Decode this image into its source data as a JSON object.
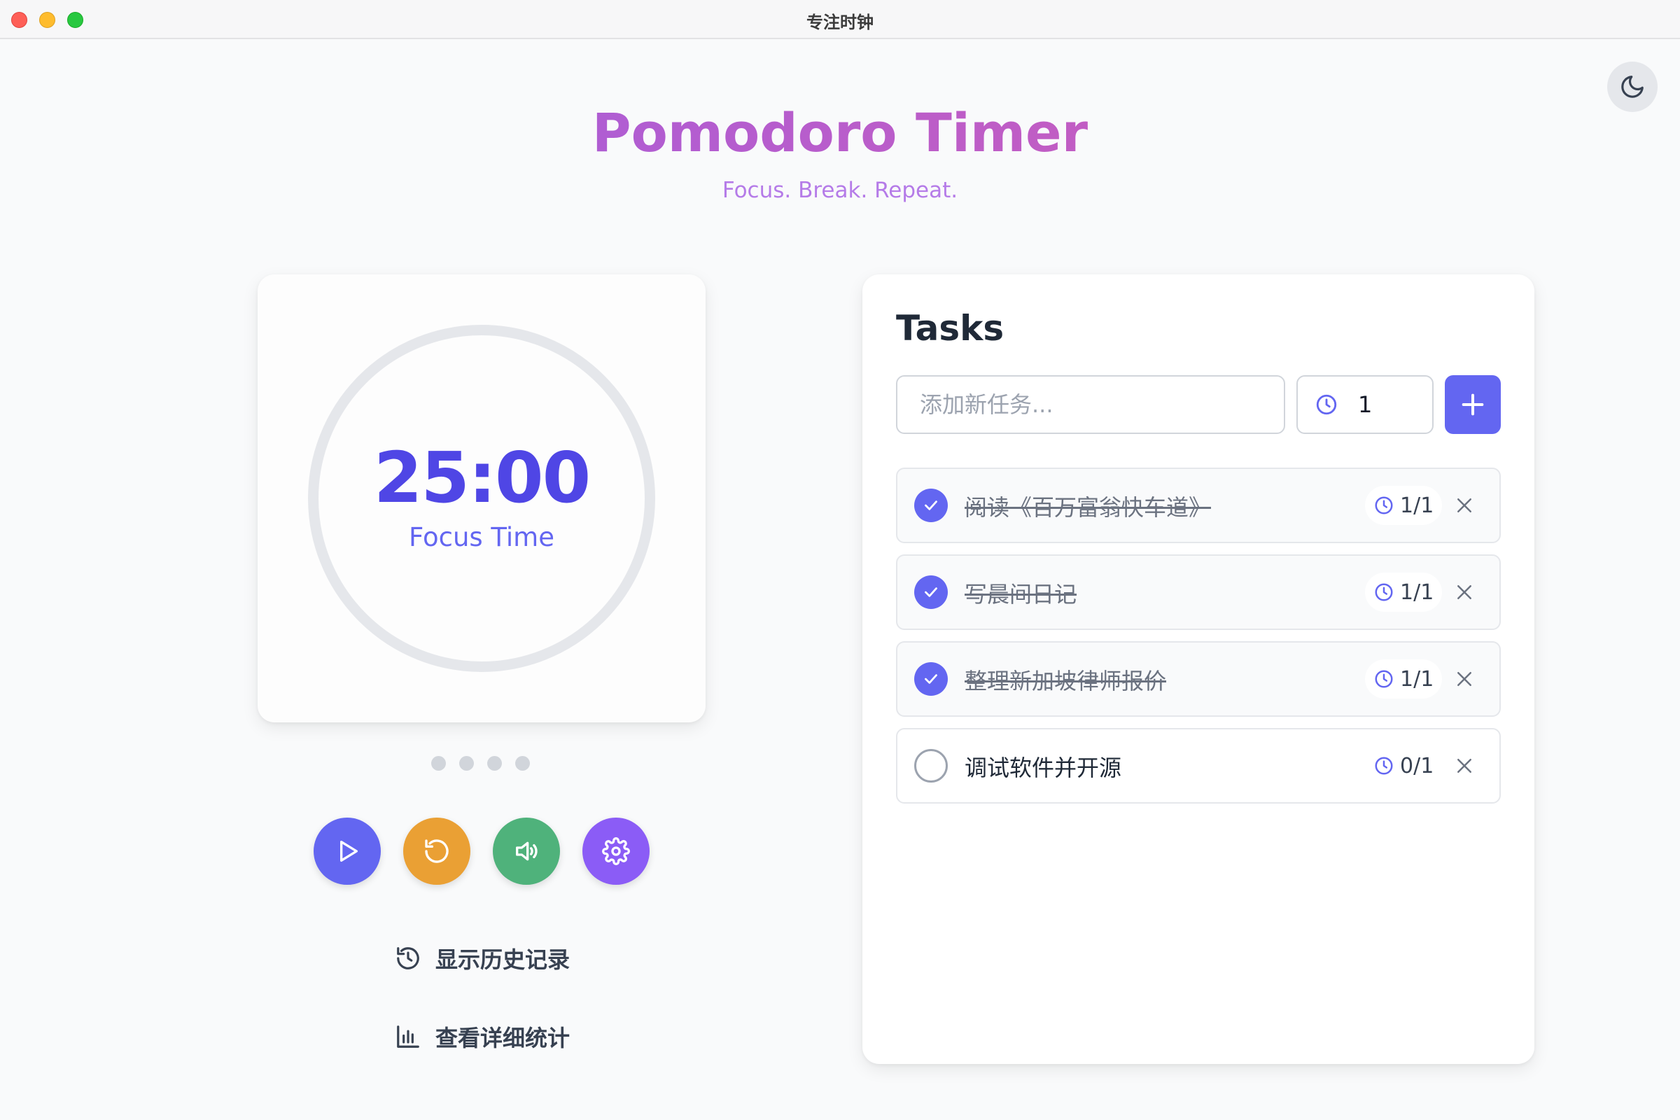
{
  "window": {
    "title": "专注时钟"
  },
  "header": {
    "title": "Pomodoro Timer",
    "subtitle": "Focus. Break. Repeat."
  },
  "timer": {
    "time": "25:00",
    "mode_label": "Focus Time",
    "session_dots": 4
  },
  "controls": {
    "play_icon": "play-icon",
    "reset_icon": "reset-icon",
    "sound_icon": "volume-icon",
    "settings_icon": "gear-icon"
  },
  "links": {
    "history_label": "显示历史记录",
    "stats_label": "查看详细统计"
  },
  "tasks": {
    "title": "Tasks",
    "input_placeholder": "添加新任务...",
    "pomodoro_count": "1",
    "items": [
      {
        "text": "阅读《百万富翁快车道》",
        "progress": "1/1",
        "done": true
      },
      {
        "text": "写晨间日记",
        "progress": "1/1",
        "done": true
      },
      {
        "text": "整理新加坡律师报价",
        "progress": "1/1",
        "done": true
      },
      {
        "text": "调试软件并开源",
        "progress": "0/1",
        "done": false
      }
    ]
  },
  "colors": {
    "primary": "#6366f1",
    "reset": "#eaa034",
    "sound": "#4fb27b",
    "settings": "#8b5cf6",
    "title_gradient_start": "#9b5de5",
    "title_gradient_end": "#d65db1"
  }
}
